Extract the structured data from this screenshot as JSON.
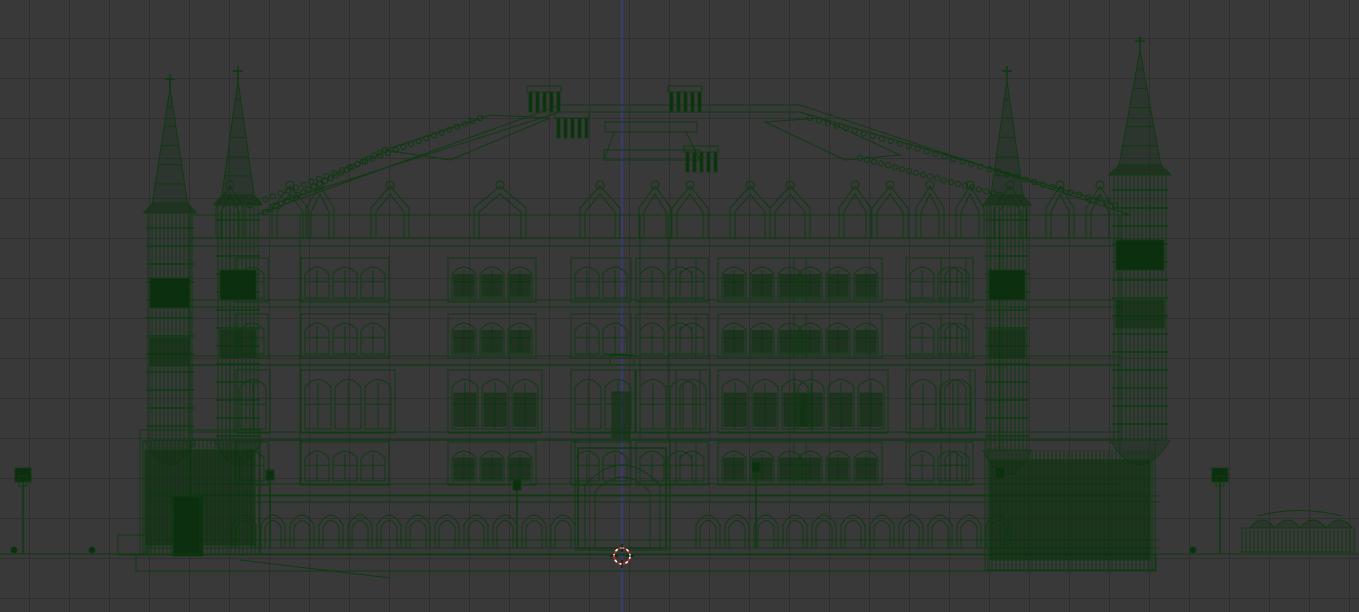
{
  "viewport": {
    "background": "#393939",
    "grid_color": "#2f2f2f",
    "wire_color": "#0f3a12",
    "axis_color": "#3a3ab0",
    "cursor_colors": [
      "#cc2020",
      "#ffffff"
    ]
  },
  "scene": {
    "object": "gothic-building-wireframe",
    "icons": [
      "3d-cursor-icon",
      "spire-cross-icon",
      "street-lamp-icon"
    ]
  }
}
